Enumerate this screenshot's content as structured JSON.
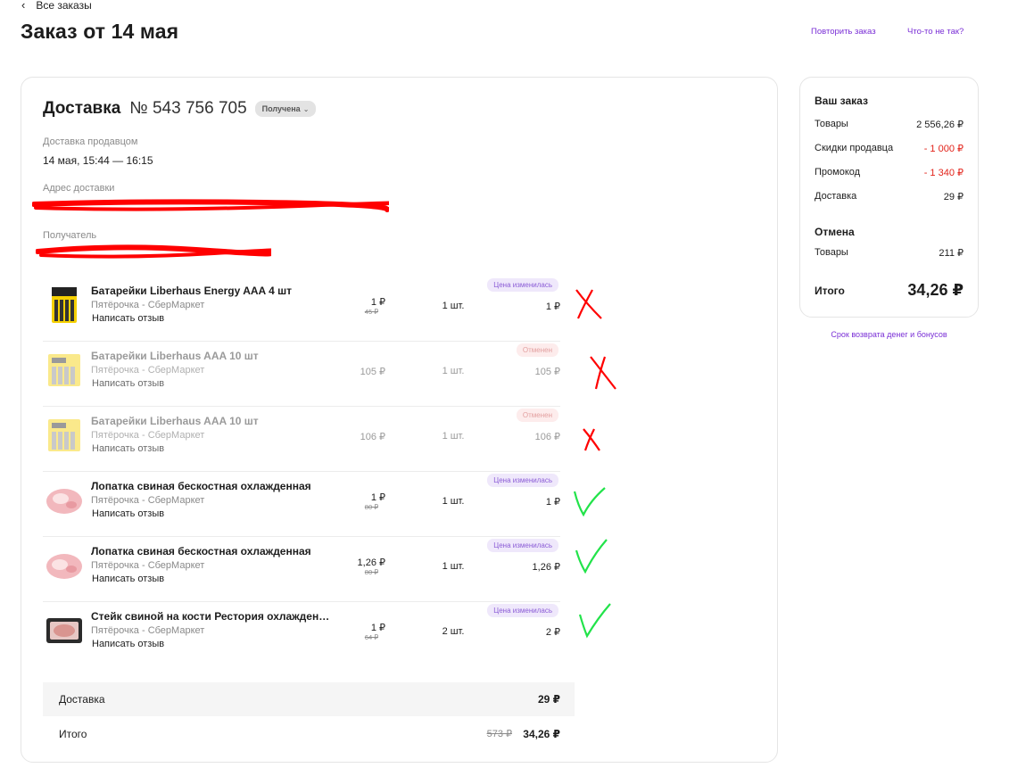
{
  "nav": {
    "back_label": "Все заказы"
  },
  "page_title": "Заказ от 14 мая",
  "actions": {
    "repeat": "Повторить заказ",
    "problem": "Что-то не так?"
  },
  "delivery": {
    "title": "Доставка",
    "number": "№ 543 756 705",
    "status": "Получена",
    "seller_label": "Доставка продавцом",
    "time": "14 мая, 15:44 — 16:15",
    "address_label": "Адрес доставки",
    "recipient_label": "Получатель"
  },
  "items": [
    {
      "name": "Батарейки Liberhaus Energy AAA 4 шт",
      "store": "Пятёрочка - СберМаркет",
      "review": "Написать отзыв",
      "price": "1 ₽",
      "old_price": "45 ₽",
      "qty": "1 шт.",
      "total": "1 ₽",
      "badge": "Цена изменилась",
      "icon": "battery-4-pack-image"
    },
    {
      "name": "Батарейки Liberhaus AAA 10 шт",
      "store": "Пятёрочка - СберМаркет",
      "review": "Написать отзыв",
      "price": "105 ₽",
      "qty": "1 шт.",
      "total": "105 ₽",
      "badge": "Отменен",
      "icon": "battery-10-pack-image"
    },
    {
      "name": "Батарейки Liberhaus AAA 10 шт",
      "store": "Пятёрочка - СберМаркет",
      "review": "Написать отзыв",
      "price": "106 ₽",
      "qty": "1 шт.",
      "total": "106 ₽",
      "badge": "Отменен",
      "icon": "battery-10-pack-image"
    },
    {
      "name": "Лопатка свиная бескостная охлажденная",
      "store": "Пятёрочка - СберМаркет",
      "review": "Написать отзыв",
      "price": "1 ₽",
      "old_price": "80 ₽",
      "qty": "1 шт.",
      "total": "1 ₽",
      "badge": "Цена изменилась",
      "icon": "pork-meat-image"
    },
    {
      "name": "Лопатка свиная бескостная охлажденная",
      "store": "Пятёрочка - СберМаркет",
      "review": "Написать отзыв",
      "price": "1,26 ₽",
      "old_price": "80 ₽",
      "qty": "1 шт.",
      "total": "1,26 ₽",
      "badge": "Цена изменилась",
      "icon": "pork-meat-image"
    },
    {
      "name": "Стейк свиной на кости Рестория охлажден…",
      "store": "Пятёрочка - СберМаркет",
      "review": "Написать отзыв",
      "price": "1 ₽",
      "old_price": "64 ₽",
      "qty": "2 шт.",
      "total": "2 ₽",
      "badge": "Цена изменилась",
      "icon": "pork-steak-pack-image"
    }
  ],
  "summary": {
    "delivery_label": "Доставка",
    "delivery_value": "29 ₽",
    "total_label": "Итого",
    "total_old": "573 ₽",
    "total_value": "34,26 ₽"
  },
  "order": {
    "title": "Ваш заказ",
    "goods_label": "Товары",
    "goods_value": "2 556,26 ₽",
    "seller_discount_label": "Скидки продавца",
    "seller_discount_value": "- 1 000 ₽",
    "promo_label": "Промокод",
    "promo_value": "- 1 340 ₽",
    "delivery_label": "Доставка",
    "delivery_value": "29 ₽",
    "cancel_title": "Отмена",
    "cancel_goods_label": "Товары",
    "cancel_goods_value": "211 ₽",
    "total_label": "Итого",
    "total_value": "34,26 ₽"
  },
  "refund_link": "Срок возврата денег и бонусов",
  "colors": {
    "accent": "#7a2fd6",
    "red": "#e2231a",
    "mark_red": "#ff0000",
    "mark_green": "#22e34a"
  }
}
